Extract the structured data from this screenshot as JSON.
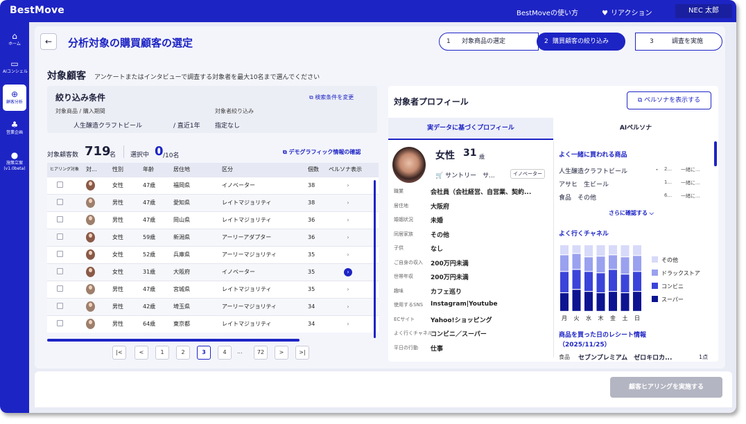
{
  "app": {
    "title": "BestMove"
  },
  "header": {
    "howto": "BestMoveの使い方",
    "reaction": "リアクション",
    "user": "NEC 太郎"
  },
  "sidebar": {
    "items": [
      {
        "label": "ホーム",
        "icon": "home-icon"
      },
      {
        "label": "AIコンシェル",
        "icon": "chat-icon"
      },
      {
        "label": "顧客分析",
        "icon": "analysis-icon",
        "active": true
      },
      {
        "label": "営業企画",
        "icon": "sprout-icon"
      },
      {
        "label": "施策立案 (v1.0beta)",
        "icon": "bulb-icon"
      }
    ]
  },
  "page": {
    "title": "分析対象の購買顧客の選定"
  },
  "steps": [
    {
      "num": "1",
      "label": "対象商品の選定"
    },
    {
      "num": "2",
      "label": "購買顧客の絞り込み"
    },
    {
      "num": "3",
      "label": "調査を実施"
    }
  ],
  "target": {
    "heading": "対象顧客",
    "desc": "アンケートまたはインタビューで調査する対象者を最大10名まで選んでください"
  },
  "filter": {
    "title": "絞り込み条件",
    "change_link": "検索条件を変更",
    "product_label": "対象商品 / 購入期間",
    "product_value": "人生醸造クラフトビール",
    "period_value": "/ 直近1年",
    "target_label": "対象者絞り込み",
    "target_value": "指定なし"
  },
  "counts": {
    "total_label": "対象顧客数",
    "total": "719",
    "total_unit": "名",
    "selected_label": "選択中",
    "selected": "0",
    "selected_unit": "/10名",
    "demo_link": "デモグラフィック情報の確認"
  },
  "table": {
    "headers": [
      "ヒアリング対象",
      "対...",
      "性別",
      "年齢",
      "居住地",
      "区分",
      "個数",
      "ペルソナ表示"
    ],
    "rows": [
      {
        "gender": "女性",
        "age": "47歳",
        "place": "福岡県",
        "segment": "イノベーター",
        "count": "38"
      },
      {
        "gender": "男性",
        "age": "47歳",
        "place": "愛知県",
        "segment": "レイトマジョリティ",
        "count": "38"
      },
      {
        "gender": "男性",
        "age": "47歳",
        "place": "岡山県",
        "segment": "レイトマジョリティ",
        "count": "36"
      },
      {
        "gender": "女性",
        "age": "59歳",
        "place": "新潟県",
        "segment": "アーリーアダプター",
        "count": "36"
      },
      {
        "gender": "女性",
        "age": "52歳",
        "place": "兵庫県",
        "segment": "アーリーマジョリティ",
        "count": "35"
      },
      {
        "gender": "女性",
        "age": "31歳",
        "place": "大阪府",
        "segment": "イノベーター",
        "count": "35"
      },
      {
        "gender": "男性",
        "age": "47歳",
        "place": "宮城県",
        "segment": "レイトマジョリティ",
        "count": "35"
      },
      {
        "gender": "男性",
        "age": "42歳",
        "place": "埼玉県",
        "segment": "アーリーマジョリティ",
        "count": "34"
      },
      {
        "gender": "男性",
        "age": "64歳",
        "place": "東京都",
        "segment": "レイトマジョリティ",
        "count": "34"
      }
    ]
  },
  "pager": {
    "first": "|<",
    "prev": "<",
    "pages": [
      "1",
      "2",
      "3",
      "4"
    ],
    "current": "3",
    "ellipsis": "...",
    "last_page": "72",
    "next": ">",
    "last": ">|"
  },
  "profile": {
    "title": "対象者プロフィール",
    "persona_button": "ペルソナを表示する",
    "tab_real": "実データに基づくプロフィール",
    "tab_ai": "AIペルソナ",
    "gender": "女性",
    "age": "31",
    "age_unit": "歳",
    "store": "サントリー　サ...",
    "badge": "イノベーター",
    "fields": [
      {
        "k": "職業",
        "v": "会社員（会社経営、自営業、契約..."
      },
      {
        "k": "居住地",
        "v": "大阪府"
      },
      {
        "k": "婚姻状況",
        "v": "未婚"
      },
      {
        "k": "同居家族",
        "v": "その他"
      },
      {
        "k": "子供",
        "v": "なし"
      },
      {
        "k": "ご自身の収入",
        "v": "200万円未満"
      },
      {
        "k": "世帯年収",
        "v": "200万円未満"
      },
      {
        "k": "趣味",
        "v": "カフェ巡り"
      },
      {
        "k": "使用するSNS",
        "v": "Instagram|Youtube"
      },
      {
        "k": "ECサイト",
        "v": "Yahoo!ショッピング"
      },
      {
        "k": "よく行くチャネル",
        "v": "コンビニ／スーパー"
      },
      {
        "k": "平日の行動",
        "v": "仕事"
      }
    ],
    "freq_title": "よく一緒に買われる商品",
    "freq_items": [
      {
        "name": "人生醸造クラフトビール",
        "dot": "・",
        "n": "2...",
        "note": "一緒に..."
      },
      {
        "name": "アサヒ　生ビール",
        "dot": "",
        "n": "1...",
        "note": "一緒に..."
      },
      {
        "name": "食品　その他",
        "dot": "",
        "n": "6...",
        "note": "一緒に..."
      }
    ],
    "more_link": "さらに確認する",
    "channel_title": "よく行くチャネル",
    "receipt_title": "商品を買った日のレシート情報",
    "receipt_date": "（2025/11/25）",
    "receipt": {
      "k": "食品",
      "v": "セブンプレミアム　ゼロキロカ...",
      "q": "1点"
    }
  },
  "chart_data": {
    "type": "bar",
    "stacked": true,
    "categories": [
      "月",
      "火",
      "水",
      "木",
      "金",
      "土",
      "日"
    ],
    "series": [
      {
        "name": "スーパー",
        "color": "#0d1490",
        "values": [
          0.28,
          0.33,
          0.3,
          0.28,
          0.3,
          0.28,
          0.3
        ]
      },
      {
        "name": "コンビニ",
        "color": "#3b44d9",
        "values": [
          0.32,
          0.3,
          0.3,
          0.3,
          0.33,
          0.28,
          0.3
        ]
      },
      {
        "name": "ドラックストア",
        "color": "#9aa1ef",
        "values": [
          0.25,
          0.24,
          0.22,
          0.25,
          0.22,
          0.26,
          0.24
        ]
      },
      {
        "name": "その他",
        "color": "#d7daf8",
        "values": [
          0.15,
          0.13,
          0.18,
          0.17,
          0.15,
          0.18,
          0.16
        ]
      }
    ],
    "ylim": [
      0,
      1
    ],
    "legend": "right"
  },
  "footer": {
    "submit": "顧客ヒアリングを実施する"
  }
}
